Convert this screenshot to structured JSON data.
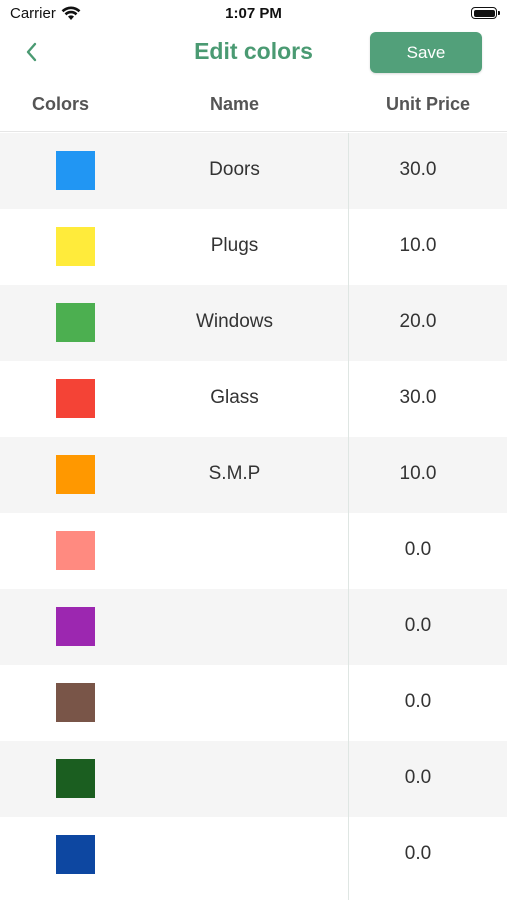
{
  "status_bar": {
    "carrier": "Carrier",
    "time": "1:07 PM"
  },
  "nav": {
    "title": "Edit colors",
    "save_label": "Save",
    "back_icon": "chevron-left-icon",
    "accent_color": "#4a9a72",
    "button_color": "#52a07a"
  },
  "table": {
    "headers": {
      "colors": "Colors",
      "name": "Name",
      "unit_price": "Unit Price"
    },
    "rows": [
      {
        "color": "#2196f3",
        "name": "Doors",
        "price": "30.0"
      },
      {
        "color": "#ffeb3b",
        "name": "Plugs",
        "price": "10.0"
      },
      {
        "color": "#4caf50",
        "name": "Windows",
        "price": "20.0"
      },
      {
        "color": "#f44336",
        "name": "Glass",
        "price": "30.0"
      },
      {
        "color": "#ff9800",
        "name": "S.M.P",
        "price": "10.0"
      },
      {
        "color": "#ff8a80",
        "name": "",
        "price": "0.0"
      },
      {
        "color": "#9c27b0",
        "name": "",
        "price": "0.0"
      },
      {
        "color": "#795548",
        "name": "",
        "price": "0.0"
      },
      {
        "color": "#1b5e20",
        "name": "",
        "price": "0.0"
      },
      {
        "color": "#0d47a1",
        "name": "",
        "price": "0.0"
      }
    ]
  }
}
